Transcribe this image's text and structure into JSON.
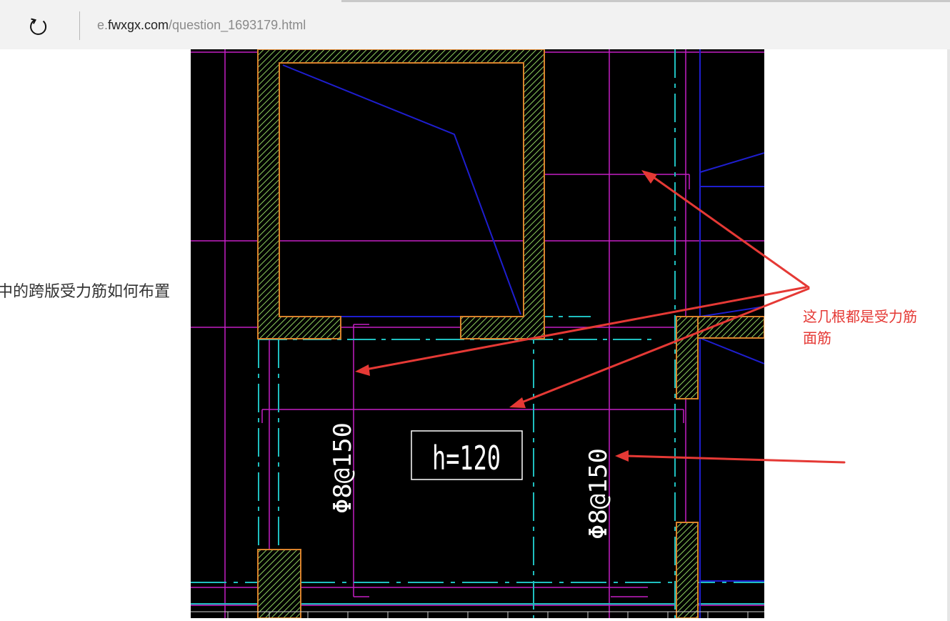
{
  "browser": {
    "url_prefix": "e.",
    "url_host": "fwxgx.com",
    "url_path": "/question_1693179.html",
    "refresh_icon": "refresh-icon"
  },
  "page": {
    "question_fragment": "中的跨版受力筋如何布置"
  },
  "drawing": {
    "label_left": "Φ8@150",
    "label_right": "Φ8@150",
    "thickness_label": "h=120",
    "colors": {
      "background": "#000000",
      "magenta": "#c41fc4",
      "cyan": "#1fbfbf",
      "blue": "#1e1ecf",
      "orange": "#d9822b",
      "hatch": "#9bd66b",
      "white": "#ffffff"
    }
  },
  "annotation": {
    "line1": "这几根都是受力筋",
    "line2": "面筋",
    "color": "#e53935"
  }
}
